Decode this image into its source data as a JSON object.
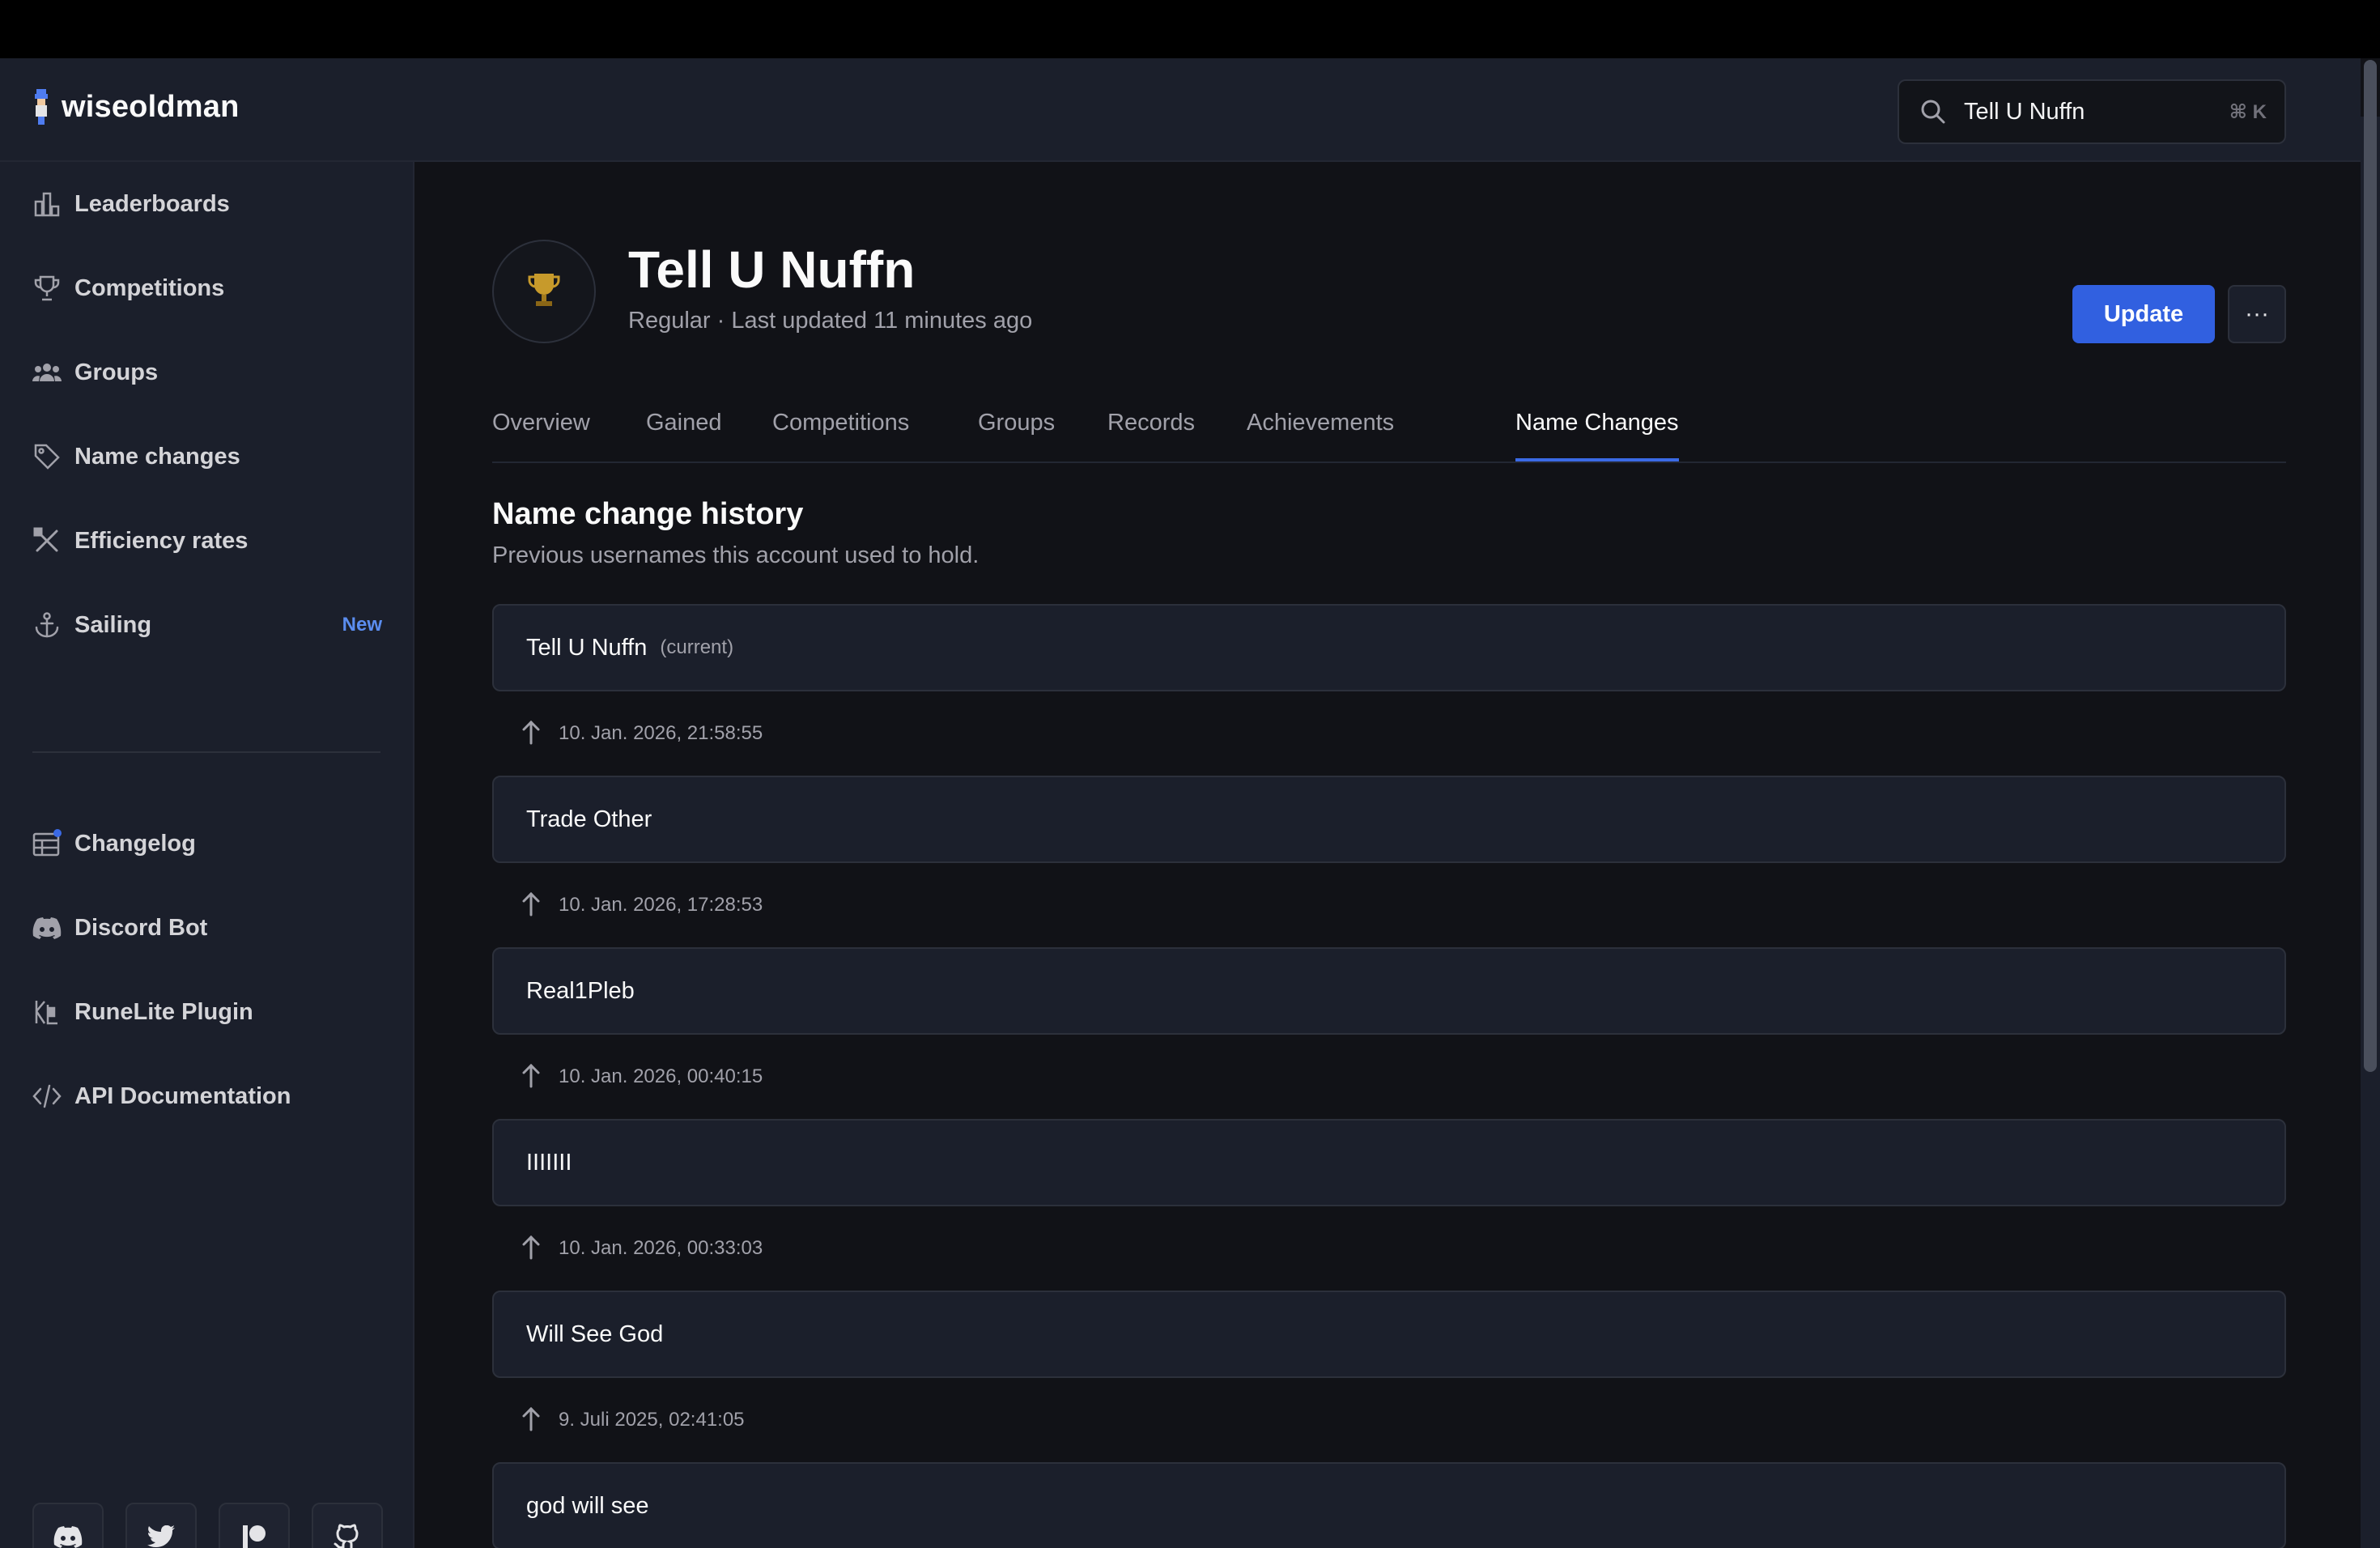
{
  "app": {
    "name": "wiseoldman"
  },
  "search": {
    "value": "Tell U Nuffn",
    "shortcut": "⌘ K"
  },
  "sidebar": {
    "items": [
      {
        "label": "Leaderboards",
        "icon": "bar-chart-icon"
      },
      {
        "label": "Competitions",
        "icon": "trophy-icon"
      },
      {
        "label": "Groups",
        "icon": "users-icon"
      },
      {
        "label": "Name changes",
        "icon": "tag-icon"
      },
      {
        "label": "Efficiency rates",
        "icon": "tools-icon"
      },
      {
        "label": "Sailing",
        "icon": "anchor-icon",
        "badge": "New"
      }
    ],
    "secondary": [
      {
        "label": "Changelog",
        "icon": "calendar-icon"
      },
      {
        "label": "Discord Bot",
        "icon": "discord-icon"
      },
      {
        "label": "RuneLite Plugin",
        "icon": "runelite-icon"
      },
      {
        "label": "API Documentation",
        "icon": "code-icon"
      }
    ],
    "social": [
      "discord-icon",
      "twitter-icon",
      "patreon-icon",
      "github-icon"
    ]
  },
  "player": {
    "name": "Tell U Nuffn",
    "meta": "Regular · Last updated 11 minutes ago",
    "update_label": "Update",
    "more_label": "···"
  },
  "tabs": [
    {
      "label": "Overview"
    },
    {
      "label": "Gained"
    },
    {
      "label": "Competitions"
    },
    {
      "label": "Groups"
    },
    {
      "label": "Records"
    },
    {
      "label": "Achievements"
    },
    {
      "label": "Name Changes",
      "active": true
    }
  ],
  "history": {
    "title": "Name change history",
    "subtitle": "Previous usernames this account used to hold.",
    "current_tag": "(current)",
    "names": [
      "Tell U Nuffn",
      "Trade Other",
      "Real1Pleb",
      "IIIIIII",
      "Will See God",
      "god will see"
    ],
    "dates": [
      "10. Jan. 2026, 21:58:55",
      "10. Jan. 2026, 17:28:53",
      "10. Jan. 2026, 00:40:15",
      "10. Jan. 2026, 00:33:03",
      "9. Juli 2025, 02:41:05"
    ]
  },
  "colors": {
    "accent": "#3160e0",
    "background": "#111217",
    "panel": "#1b1f2b",
    "badge": "#5b8def"
  }
}
